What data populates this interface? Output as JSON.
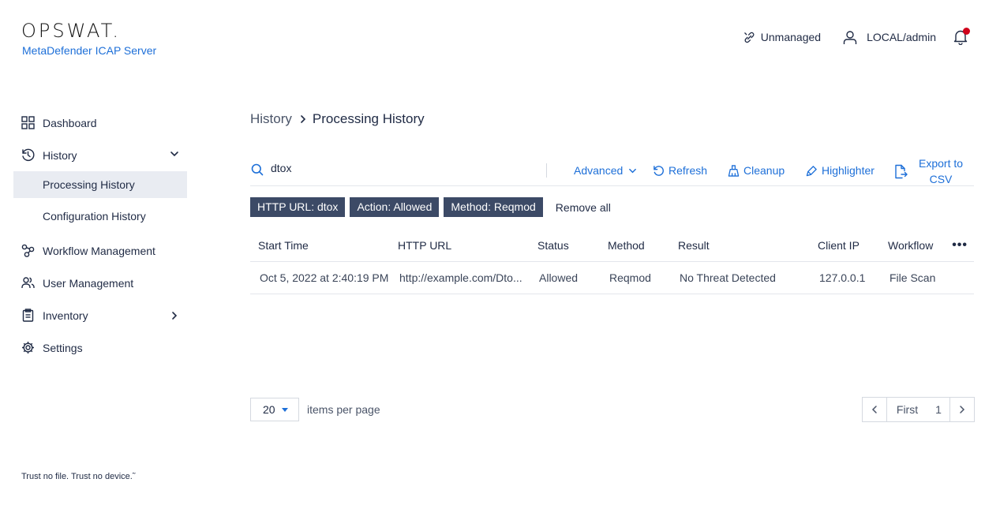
{
  "brand": {
    "logo": "OPSWAT.",
    "product": "MetaDefender ICAP Server",
    "tagline": "Trust no file. Trust no device.˜"
  },
  "topbar": {
    "unmanaged_label": "Unmanaged",
    "user_label": "LOCAL/admin",
    "notification_color": "#d0021b"
  },
  "sidebar": {
    "items": [
      {
        "label": "Dashboard",
        "icon": "dashboard-grid-icon"
      },
      {
        "label": "History",
        "icon": "history-icon",
        "expanded": true
      },
      {
        "label": "Workflow Management",
        "icon": "workflow-icon"
      },
      {
        "label": "User Management",
        "icon": "users-icon"
      },
      {
        "label": "Inventory",
        "icon": "clipboard-icon"
      },
      {
        "label": "Settings",
        "icon": "gear-icon"
      }
    ],
    "history_sub": [
      {
        "label": "Processing History",
        "active": true
      },
      {
        "label": "Configuration History",
        "active": false
      }
    ]
  },
  "breadcrumb": {
    "root": "History",
    "current": "Processing History"
  },
  "toolbar": {
    "search_value": "dtox",
    "advanced_label": "Advanced",
    "refresh_label": "Refresh",
    "cleanup_label": "Cleanup",
    "highlighter_label": "Highlighter",
    "export_line1": "Export to",
    "export_line2": "CSV",
    "accent_color": "#1d6fd8"
  },
  "filters": {
    "chips": [
      "HTTP URL: dtox",
      "Action: Allowed",
      "Method: Reqmod"
    ],
    "remove_all": "Remove all"
  },
  "table": {
    "columns": [
      "Start Time",
      "HTTP URL",
      "Status",
      "Method",
      "Result",
      "Client IP",
      "Workflow"
    ],
    "more_label": "•••",
    "rows": [
      {
        "start_time": "Oct 5, 2022 at 2:40:19 PM",
        "http_url": "http://example.com/Dto...",
        "status": "Allowed",
        "method": "Reqmod",
        "result": "No Threat Detected",
        "client_ip": "127.0.0.1",
        "workflow": "File Scan"
      }
    ]
  },
  "pagination": {
    "page_size": "20",
    "per_page_label": "items per page",
    "first_label": "First",
    "current_page": "1"
  }
}
